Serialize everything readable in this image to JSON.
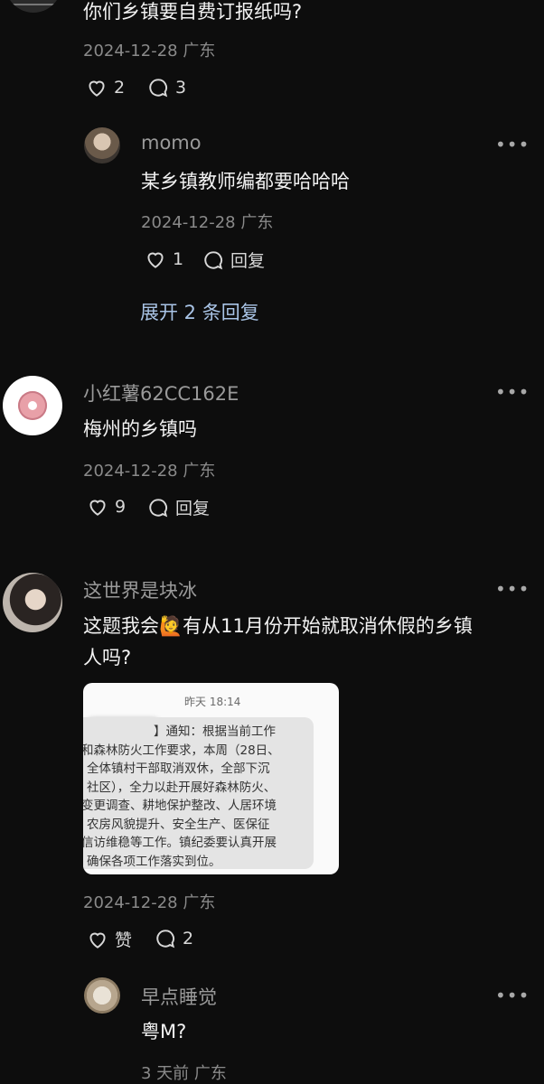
{
  "comment_top": {
    "text": "你们乡镇要自费订报纸吗?",
    "meta": "2024-12-28 广东",
    "likes": "2",
    "replies": "3"
  },
  "reply_momo": {
    "name": "momo",
    "text": "某乡镇教师编都要哈哈哈",
    "meta": "2024-12-28 广东",
    "likes": "1",
    "reply_label": "回复"
  },
  "expand_label": "展开 2 条回复",
  "comment_2": {
    "name": "小红薯62CC162E",
    "text": "梅州的乡镇吗",
    "meta": "2024-12-28 广东",
    "likes": "9",
    "reply_label": "回复"
  },
  "comment_3": {
    "name": "这世界是块冰",
    "text_line1": "这题我会🙋有从11月份开始就取消休假的乡镇",
    "text_line2": "人吗?",
    "meta": "2024-12-28 广东",
    "likes": "赞",
    "replies": "2",
    "screenshot": {
      "time": "昨天 18:14",
      "lines": [
        "】通知：根据当前工作",
        "和森林防火工作要求，本周（28日、",
        "全体镇村干部取消双休，全部下沉",
        "社区），全力以赴开展好森林防火、",
        "变更调查、耕地保护整改、人居环境",
        "农房风貌提升、安全生产、医保征",
        "信访维稳等工作。镇纪委要认真开展",
        "确保各项工作落实到位。"
      ]
    }
  },
  "reply_sleep": {
    "name": "早点睡觉",
    "text": "粤M?",
    "meta": "3 天前 广东"
  },
  "more_icon": "•••",
  "colors": {
    "background": "#0d0d0d",
    "expand_link": "#a9c4e6",
    "meta": "#8a8a8a"
  }
}
